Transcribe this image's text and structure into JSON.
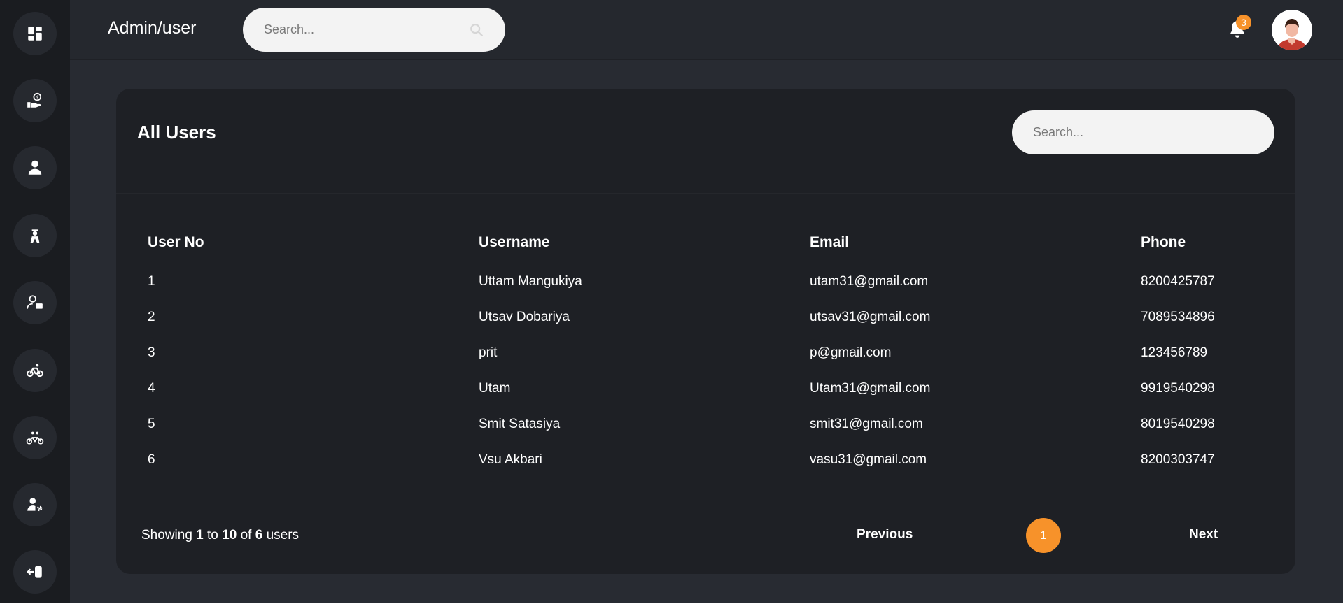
{
  "header": {
    "breadcrumb": "Admin/user",
    "search_placeholder": "Search...",
    "notification_count": "3"
  },
  "sidebar": {
    "icons": [
      "dashboard-icon",
      "payment-icon",
      "user-icon",
      "delivery-person-icon",
      "user-chat-icon",
      "bike-icon",
      "tandem-bike-icon",
      "user-settings-icon",
      "logout-icon"
    ]
  },
  "card": {
    "title": "All Users",
    "search_placeholder": "Search...",
    "columns": [
      "User No",
      "Username",
      "Email",
      "Phone"
    ],
    "rows": [
      [
        "1",
        "Uttam Mangukiya",
        "utam31@gmail.com",
        "8200425787"
      ],
      [
        "2",
        "Utsav Dobariya",
        "utsav31@gmail.com",
        "7089534896"
      ],
      [
        "3",
        "prit",
        "p@gmail.com",
        "123456789"
      ],
      [
        "4",
        "Utam",
        "Utam31@gmail.com",
        "9919540298"
      ],
      [
        "5",
        "Smit Satasiya",
        "smit31@gmail.com",
        "8019540298"
      ],
      [
        "6",
        "Vsu Akbari",
        "vasu31@gmail.com",
        "8200303747"
      ]
    ]
  },
  "pagination": {
    "showing_prefix": "Showing",
    "from": "1",
    "to_word": "to",
    "to": "10",
    "of_word": "of",
    "total": "6",
    "suffix": "users",
    "previous": "Previous",
    "current_page": "1",
    "next": "Next"
  },
  "colors": {
    "accent": "#f7922a",
    "background": "#282b32",
    "sidebar": "#1a1c20",
    "card": "#1e2025"
  }
}
